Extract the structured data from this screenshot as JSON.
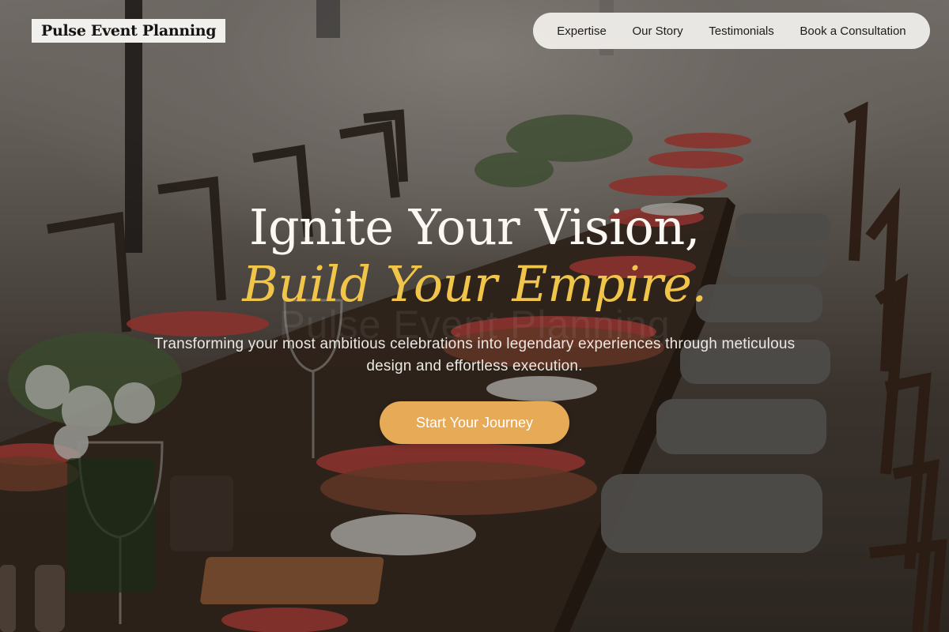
{
  "brand": {
    "logo_text": "Pulse Event Planning"
  },
  "nav": {
    "items": [
      {
        "label": "Expertise"
      },
      {
        "label": "Our Story"
      },
      {
        "label": "Testimonials"
      },
      {
        "label": "Book a Consultation"
      }
    ]
  },
  "hero": {
    "headline_line1": "Ignite Your Vision,",
    "headline_line2": "Build Your Empire.",
    "subtitle": "Transforming your most ambitious celebrations into legendary experiences through meticulous design and effortless execution.",
    "cta_label": "Start Your Journey",
    "watermark_text": "Pulse Event Planning"
  },
  "colors": {
    "accent_gold": "#f1c54a",
    "cta_background": "#e7ab57",
    "nav_background": "#eeece8",
    "logo_background": "#f2f0ec"
  },
  "background": {
    "image_subject": "outdoor banquet table set with red napkins, woven chargers, glassware and wooden chairs on a beach"
  }
}
